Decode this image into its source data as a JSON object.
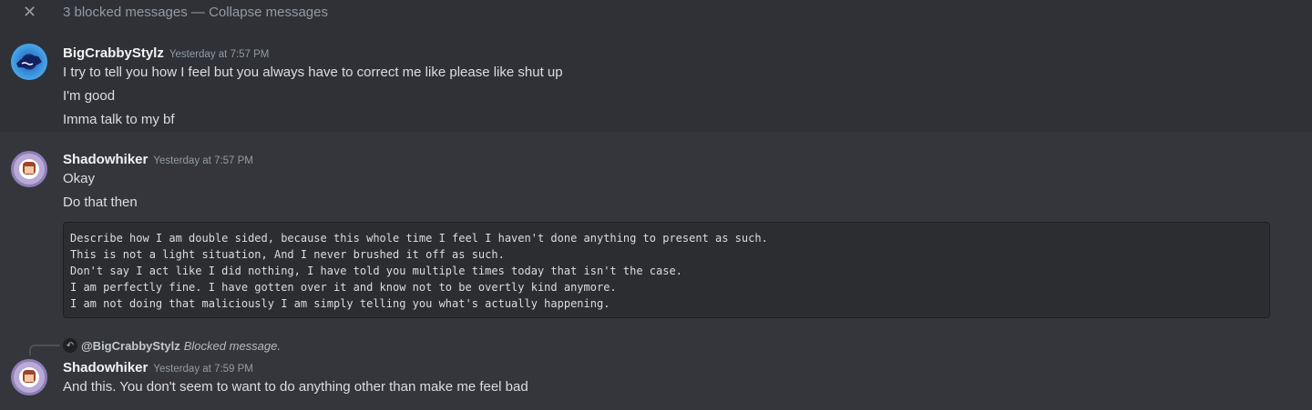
{
  "blocked_bar": {
    "label": "3 blocked messages — Collapse messages",
    "close_icon": "close-icon"
  },
  "messages": [
    {
      "author": "BigCrabbyStylz",
      "timestamp": "Yesterday at 7:57 PM",
      "lines": [
        "I try to tell you how I feel but you always have to correct me like please like shut up",
        "I'm good",
        "Imma talk to my bf"
      ]
    },
    {
      "author": "Shadowhiker",
      "timestamp": "Yesterday at 7:57 PM",
      "lines": [
        "Okay",
        "Do that then"
      ],
      "code": "Describe how I am double sided, because this whole time I feel I haven't done anything to present as such.\nThis is not a light situation, And I never brushed it off as such.\nDon't say I act like I did nothing, I have told you multiple times today that isn't the case.\nI am perfectly fine. I have gotten over it and know not to be overtly kind anymore.\nI am not doing that maliciously I am simply telling you what's actually happening."
    },
    {
      "author": "Shadowhiker",
      "timestamp": "Yesterday at 7:59 PM",
      "reply": {
        "mention": "@BigCrabbyStylz",
        "text": "Blocked message."
      },
      "lines": [
        "And this. You don't seem to want to do anything other than make me feel bad"
      ]
    }
  ]
}
